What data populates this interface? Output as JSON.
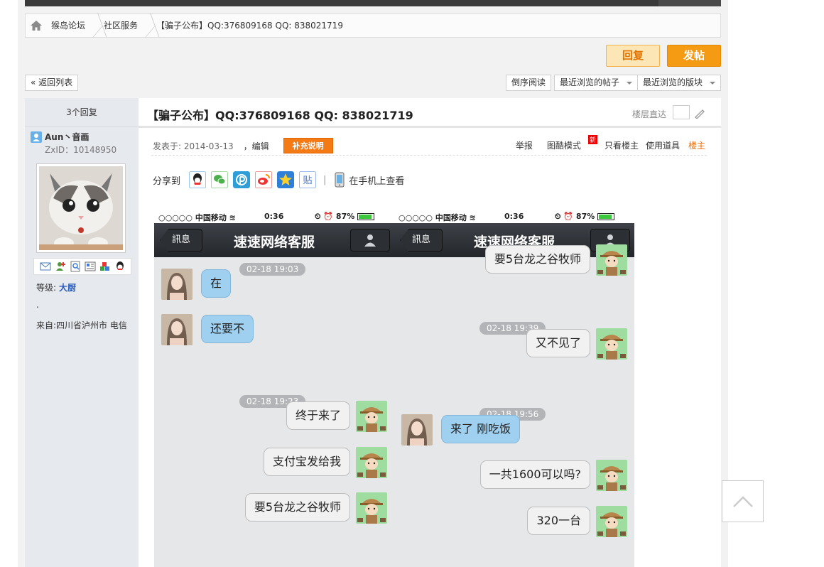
{
  "breadcrumb": {
    "home": "猴岛论坛",
    "section": "社区服务",
    "thread": "【骗子公布】QQ:376809168 QQ: 838021719"
  },
  "actions": {
    "reply": "回复",
    "post": "发帖",
    "back": "« 返回列表",
    "reverse": "倒序阅读",
    "recent_posts": "最近浏览的帖子",
    "recent_boards": "最近浏览的版块"
  },
  "sidebar": {
    "replies": "3个回复",
    "username": "Aun丶音画",
    "user_id": "ZxID：10148950",
    "level_label": "等级:",
    "level_value": "大厨",
    "dot": ".",
    "from": "来自:四川省泸州市 电信"
  },
  "post": {
    "title": "【骗子公布】QQ:376809168 QQ: 838021719",
    "floor_jump": "楼层直达",
    "posted": "发表于: 2014-03-13",
    "edit": "，编辑",
    "supplement": "补充说明",
    "report": "举报",
    "pic_mode": "图酷模式",
    "new_tag": "新",
    "only_owner": "只看楼主",
    "use_tool": "使用道具",
    "owner": "楼主",
    "share_label": "分享到",
    "share_sep": "|",
    "mobile": "在手机上查看"
  },
  "chat": {
    "carrier": "○○○○○ 中国移动 ≋",
    "time": "0:36",
    "battery": "⏲ ⏰ 87%",
    "back": "訊息",
    "title": "速速网络客服",
    "left_panel": [
      {
        "type": "ts",
        "text": "02-18 19:03"
      },
      {
        "type": "l",
        "text": "在"
      },
      {
        "type": "l",
        "text": "还要不"
      },
      {
        "type": "ts",
        "text": "02-18 19:23"
      },
      {
        "type": "r",
        "text": "终于来了"
      },
      {
        "type": "r",
        "text": "支付宝发给我"
      },
      {
        "type": "r",
        "text": "要5台龙之谷牧师"
      }
    ],
    "right_panel": [
      {
        "type": "r",
        "text": "要5台龙之谷牧师"
      },
      {
        "type": "ts",
        "text": "02-18 19:39"
      },
      {
        "type": "r",
        "text": "又不见了"
      },
      {
        "type": "ts",
        "text": "02-18 19:56"
      },
      {
        "type": "l",
        "text": "来了 刚吃饭"
      },
      {
        "type": "r",
        "text": "一共1600可以吗?"
      },
      {
        "type": "r",
        "text": "320一台"
      }
    ]
  },
  "colors": {
    "accent_orange": "#f49b13",
    "owner_orange": "#f26c00",
    "level_blue": "#2a5bb8"
  }
}
